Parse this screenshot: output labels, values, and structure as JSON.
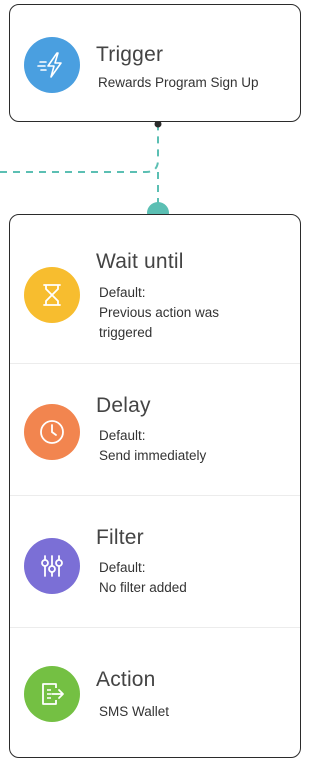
{
  "trigger": {
    "title": "Trigger",
    "subtitle": "Rewards Program Sign Up",
    "icon": "lightning-icon",
    "color": "#4a9fe0"
  },
  "steps": [
    {
      "title": "Wait until",
      "line1": "Default:",
      "line2": "Previous action was",
      "line3": "triggered",
      "icon": "hourglass-icon",
      "color": "#f7bd2f"
    },
    {
      "title": "Delay",
      "line1": "Default:",
      "line2": "Send immediately",
      "icon": "clock-icon",
      "color": "#f2854f"
    },
    {
      "title": "Filter",
      "line1": "Default:",
      "line2": "No filter added",
      "icon": "sliders-icon",
      "color": "#7b6fd6"
    },
    {
      "title": "Action",
      "line1": "SMS Wallet",
      "icon": "export-icon",
      "color": "#74c043"
    }
  ],
  "connector": {
    "color": "#5bbfb3",
    "dot_color": "#2b2b2b"
  }
}
